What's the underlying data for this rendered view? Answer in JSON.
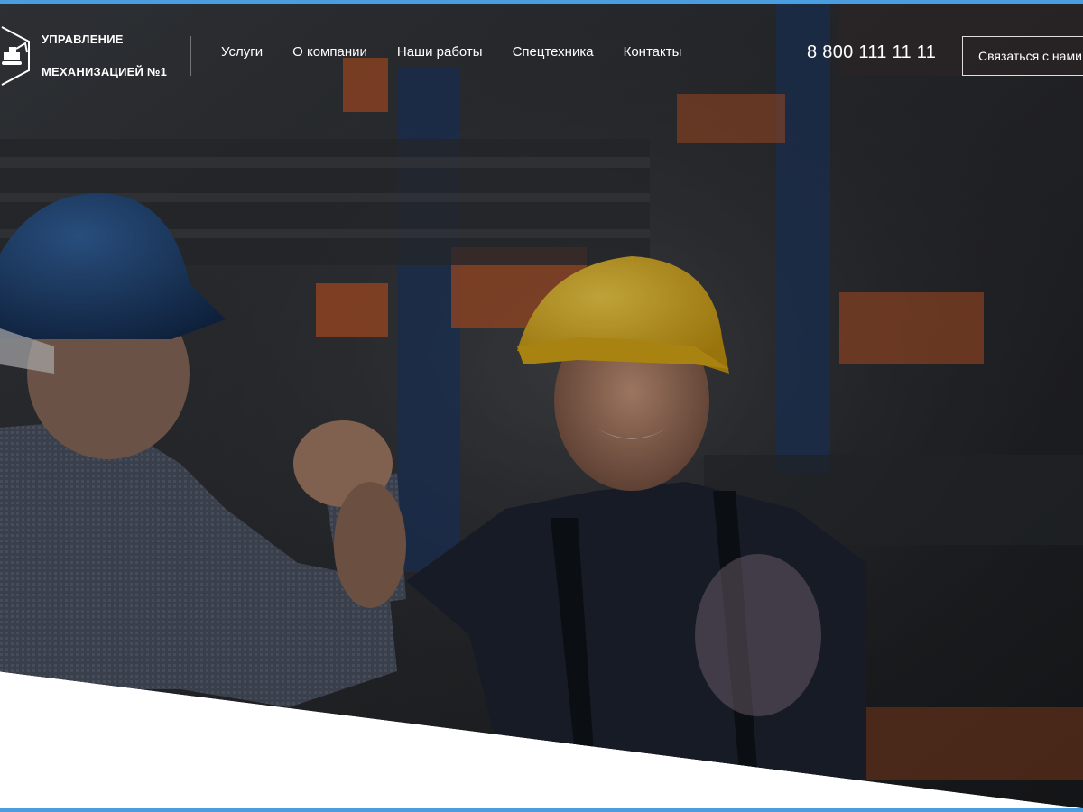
{
  "brand": {
    "line1": "Управление",
    "line2": "механизацией №1",
    "logo_icon": "excavator-hexagon-icon"
  },
  "nav": {
    "items": [
      {
        "label": "Услуги"
      },
      {
        "label": "О компании"
      },
      {
        "label": "Наши работы"
      },
      {
        "label": "Спецтехника"
      },
      {
        "label": "Контакты"
      }
    ]
  },
  "header": {
    "phone": "8 800 111 11 11",
    "cta_label": "Связаться с нами"
  },
  "hero": {
    "image": "two-workers-in-hard-hats-handshake-in-warehouse"
  },
  "colors": {
    "accent_border": "#4a9ee0",
    "overlay": "#1d1f22",
    "helmet_yellow": "#e8b81e",
    "helmet_blue": "#1e3f6e",
    "rack_orange": "#c45a2a"
  }
}
